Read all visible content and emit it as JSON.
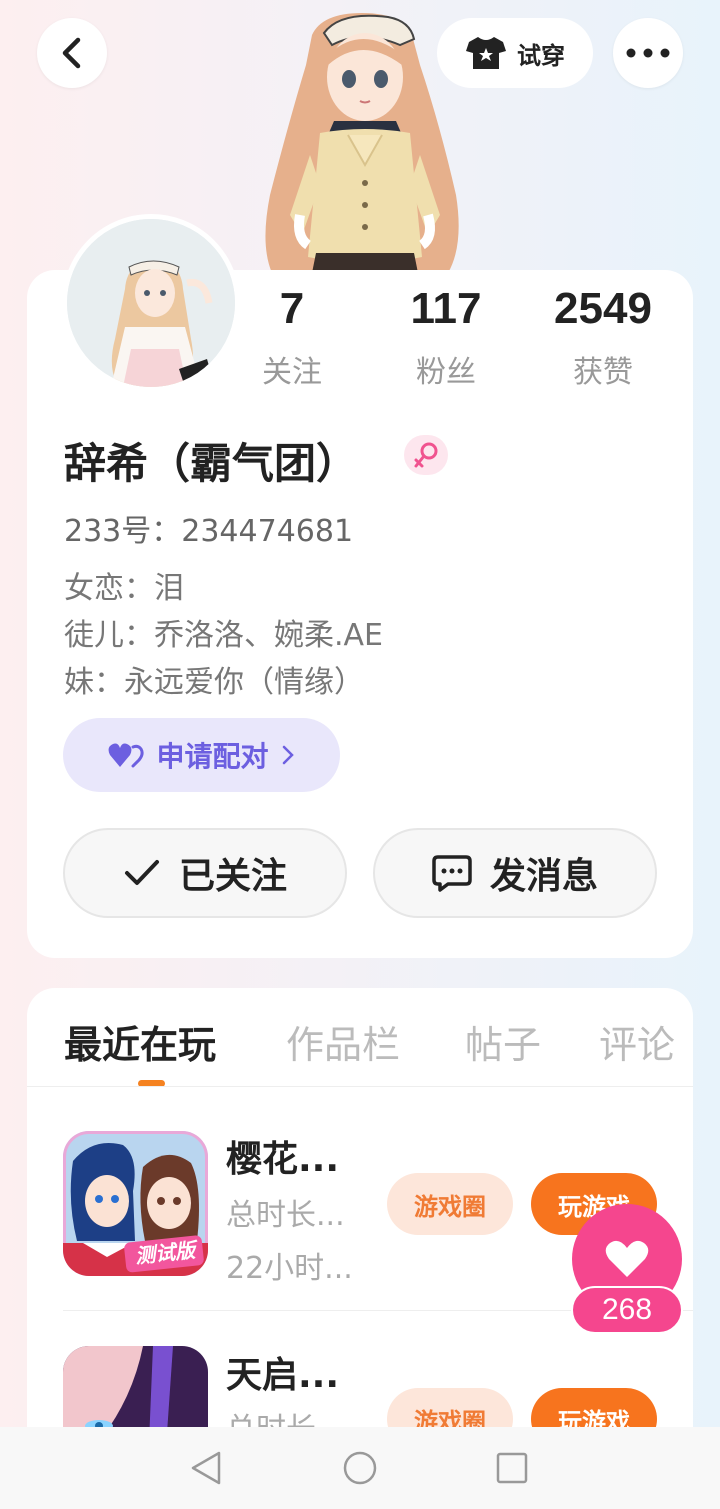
{
  "header": {
    "tryon_label": "试穿"
  },
  "stats": [
    {
      "value": "7",
      "label": "关注"
    },
    {
      "value": "117",
      "label": "粉丝"
    },
    {
      "value": "2549",
      "label": "获赞"
    }
  ],
  "profile": {
    "nickname": "辞希（霸气团）",
    "uid": "233号：234474681",
    "bio": [
      "女恋：泪",
      "徒儿：乔洛洛、婉柔.AE",
      "妹：永远爱你（情缘）"
    ],
    "pair_label": "申请配对",
    "follow_label": "已关注",
    "message_label": "发消息"
  },
  "tabs": [
    "最近在玩",
    "作品栏",
    "帖子",
    "评论"
  ],
  "games": [
    {
      "title": "樱花...",
      "meta1": "总时长...",
      "meta2": "22小时...",
      "circle_label": "游戏圈",
      "play_label": "玩游戏",
      "icon_badge": "测试版"
    },
    {
      "title": "天启...",
      "meta1": "总时长...",
      "meta2": "",
      "circle_label": "游戏圈",
      "play_label": "玩游戏"
    }
  ],
  "like": {
    "count": "268"
  },
  "colors": {
    "accent_orange": "#f7741e",
    "like_pink": "#f5468e",
    "pair_purple": "#6c5fe0"
  }
}
